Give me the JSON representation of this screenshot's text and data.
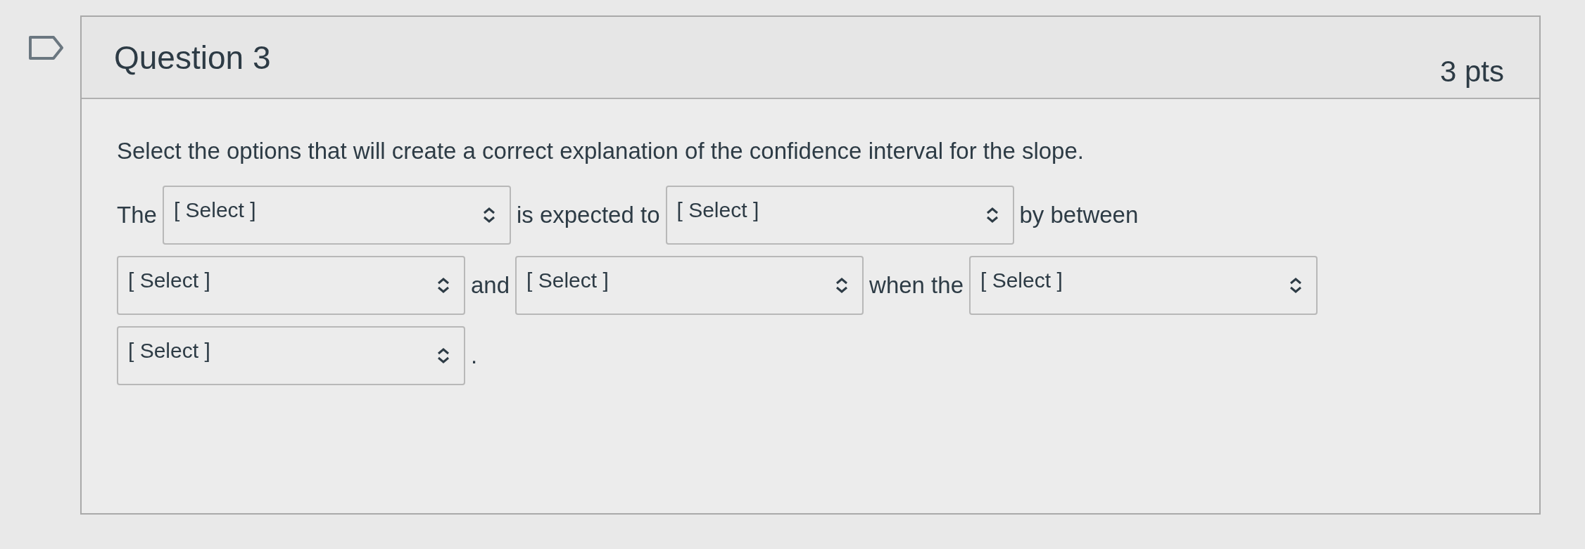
{
  "question": {
    "title": "Question 3",
    "points": "3 pts",
    "prompt": "Select the options that will create a correct explanation of the confidence interval for the slope.",
    "parts": [
      {
        "kind": "text",
        "text": "The"
      },
      {
        "kind": "select",
        "value": "[ Select ]"
      },
      {
        "kind": "text",
        "text": "is expected to"
      },
      {
        "kind": "select",
        "value": "[ Select ]"
      },
      {
        "kind": "text",
        "text": "by between"
      },
      {
        "kind": "select",
        "value": "[ Select ]"
      },
      {
        "kind": "text",
        "text": "and"
      },
      {
        "kind": "select",
        "value": "[ Select ]"
      },
      {
        "kind": "text",
        "text": "when the"
      },
      {
        "kind": "select",
        "value": "[ Select ]"
      },
      {
        "kind": "select",
        "value": "[ Select ]"
      },
      {
        "kind": "text",
        "text": "."
      }
    ]
  }
}
